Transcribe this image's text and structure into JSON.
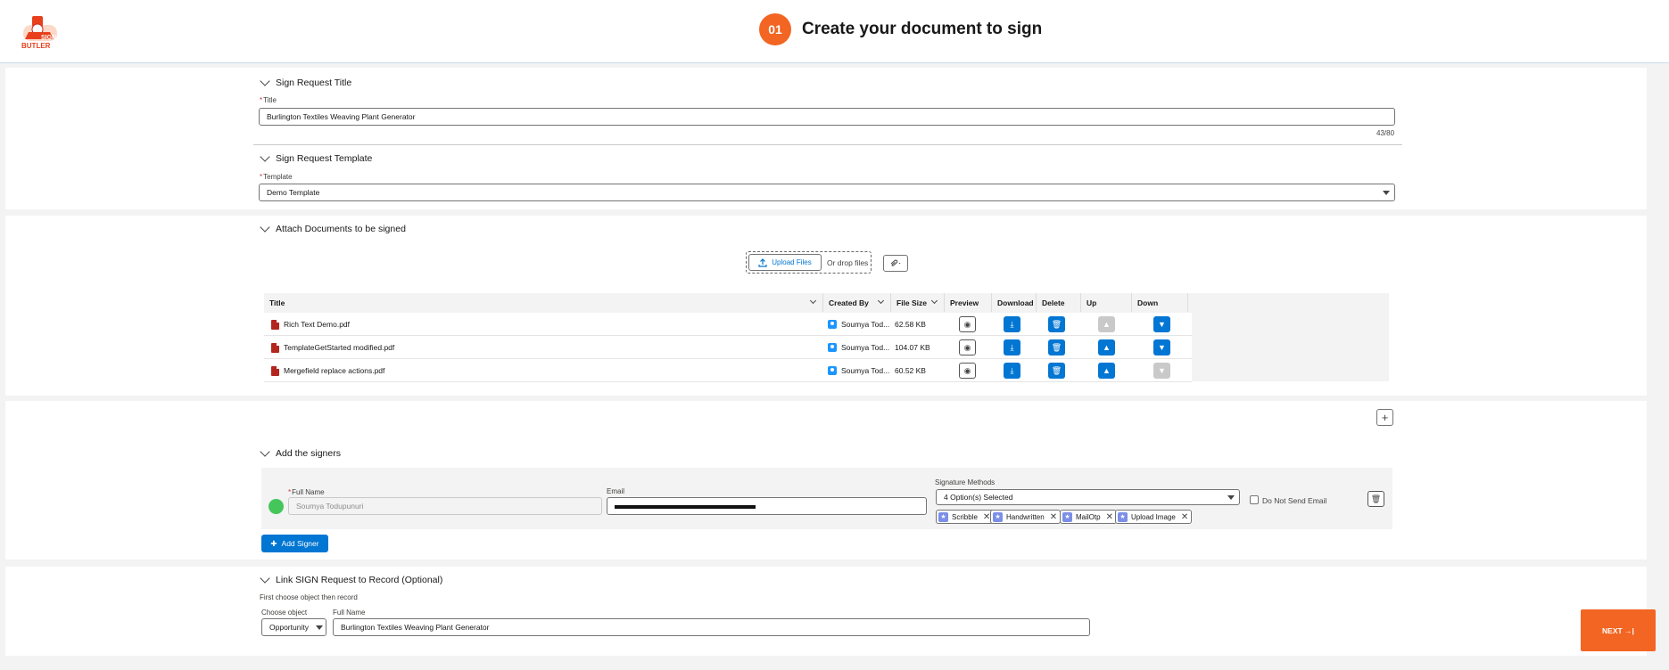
{
  "header": {
    "logo_text": "SIGN BUTLER",
    "step_number": "01",
    "step_title": "Create your document to sign"
  },
  "title_section": {
    "heading": "Sign Request Title",
    "field_label": "Title",
    "field_value": "Burlington Textiles Weaving Plant Generator",
    "counter": "43/80"
  },
  "template_section": {
    "heading": "Sign Request Template",
    "field_label": "Template",
    "field_value": "Demo Template"
  },
  "attach_section": {
    "heading": "Attach Documents to be signed",
    "upload_label": "Upload Files",
    "drop_label": "Or drop files",
    "columns": [
      "Title",
      "Created By",
      "File Size",
      "Preview",
      "Download",
      "Delete",
      "Up",
      "Down"
    ],
    "rows": [
      {
        "title": "Rich Text Demo.pdf",
        "created_by": "Soumya Tod...",
        "size": "62.58 KB",
        "up_enabled": false,
        "down_enabled": true
      },
      {
        "title": "TemplateGetStarted modified.pdf",
        "created_by": "Soumya Tod...",
        "size": "104.07 KB",
        "up_enabled": true,
        "down_enabled": true
      },
      {
        "title": "Mergefield replace actions.pdf",
        "created_by": "Soumya Tod...",
        "size": "60.52 KB",
        "up_enabled": true,
        "down_enabled": false
      }
    ]
  },
  "signers_section": {
    "heading": "Add the signers",
    "full_name_label": "Full Name",
    "full_name_value": "Soumya Todupunuri",
    "email_label": "Email",
    "sig_methods_label": "Signature Methods",
    "sig_methods_value": "4 Option(s) Selected",
    "methods": [
      "Scribble",
      "Handwritten",
      "MailOtp",
      "Upload Image"
    ],
    "do_not_send_label": "Do Not Send Email",
    "add_signer_label": "Add Signer"
  },
  "link_section": {
    "heading": "Link SIGN Request to Record (Optional)",
    "hint": "First choose object then record",
    "object_label": "Choose object",
    "object_value": "Opportunity",
    "record_label": "Full Name",
    "record_value": "Burlington Textiles Weaving Plant Generator"
  },
  "footer": {
    "next_label": "NEXT →|"
  },
  "colors": {
    "accent": "#f26522",
    "brand_blue": "#0176d3"
  }
}
